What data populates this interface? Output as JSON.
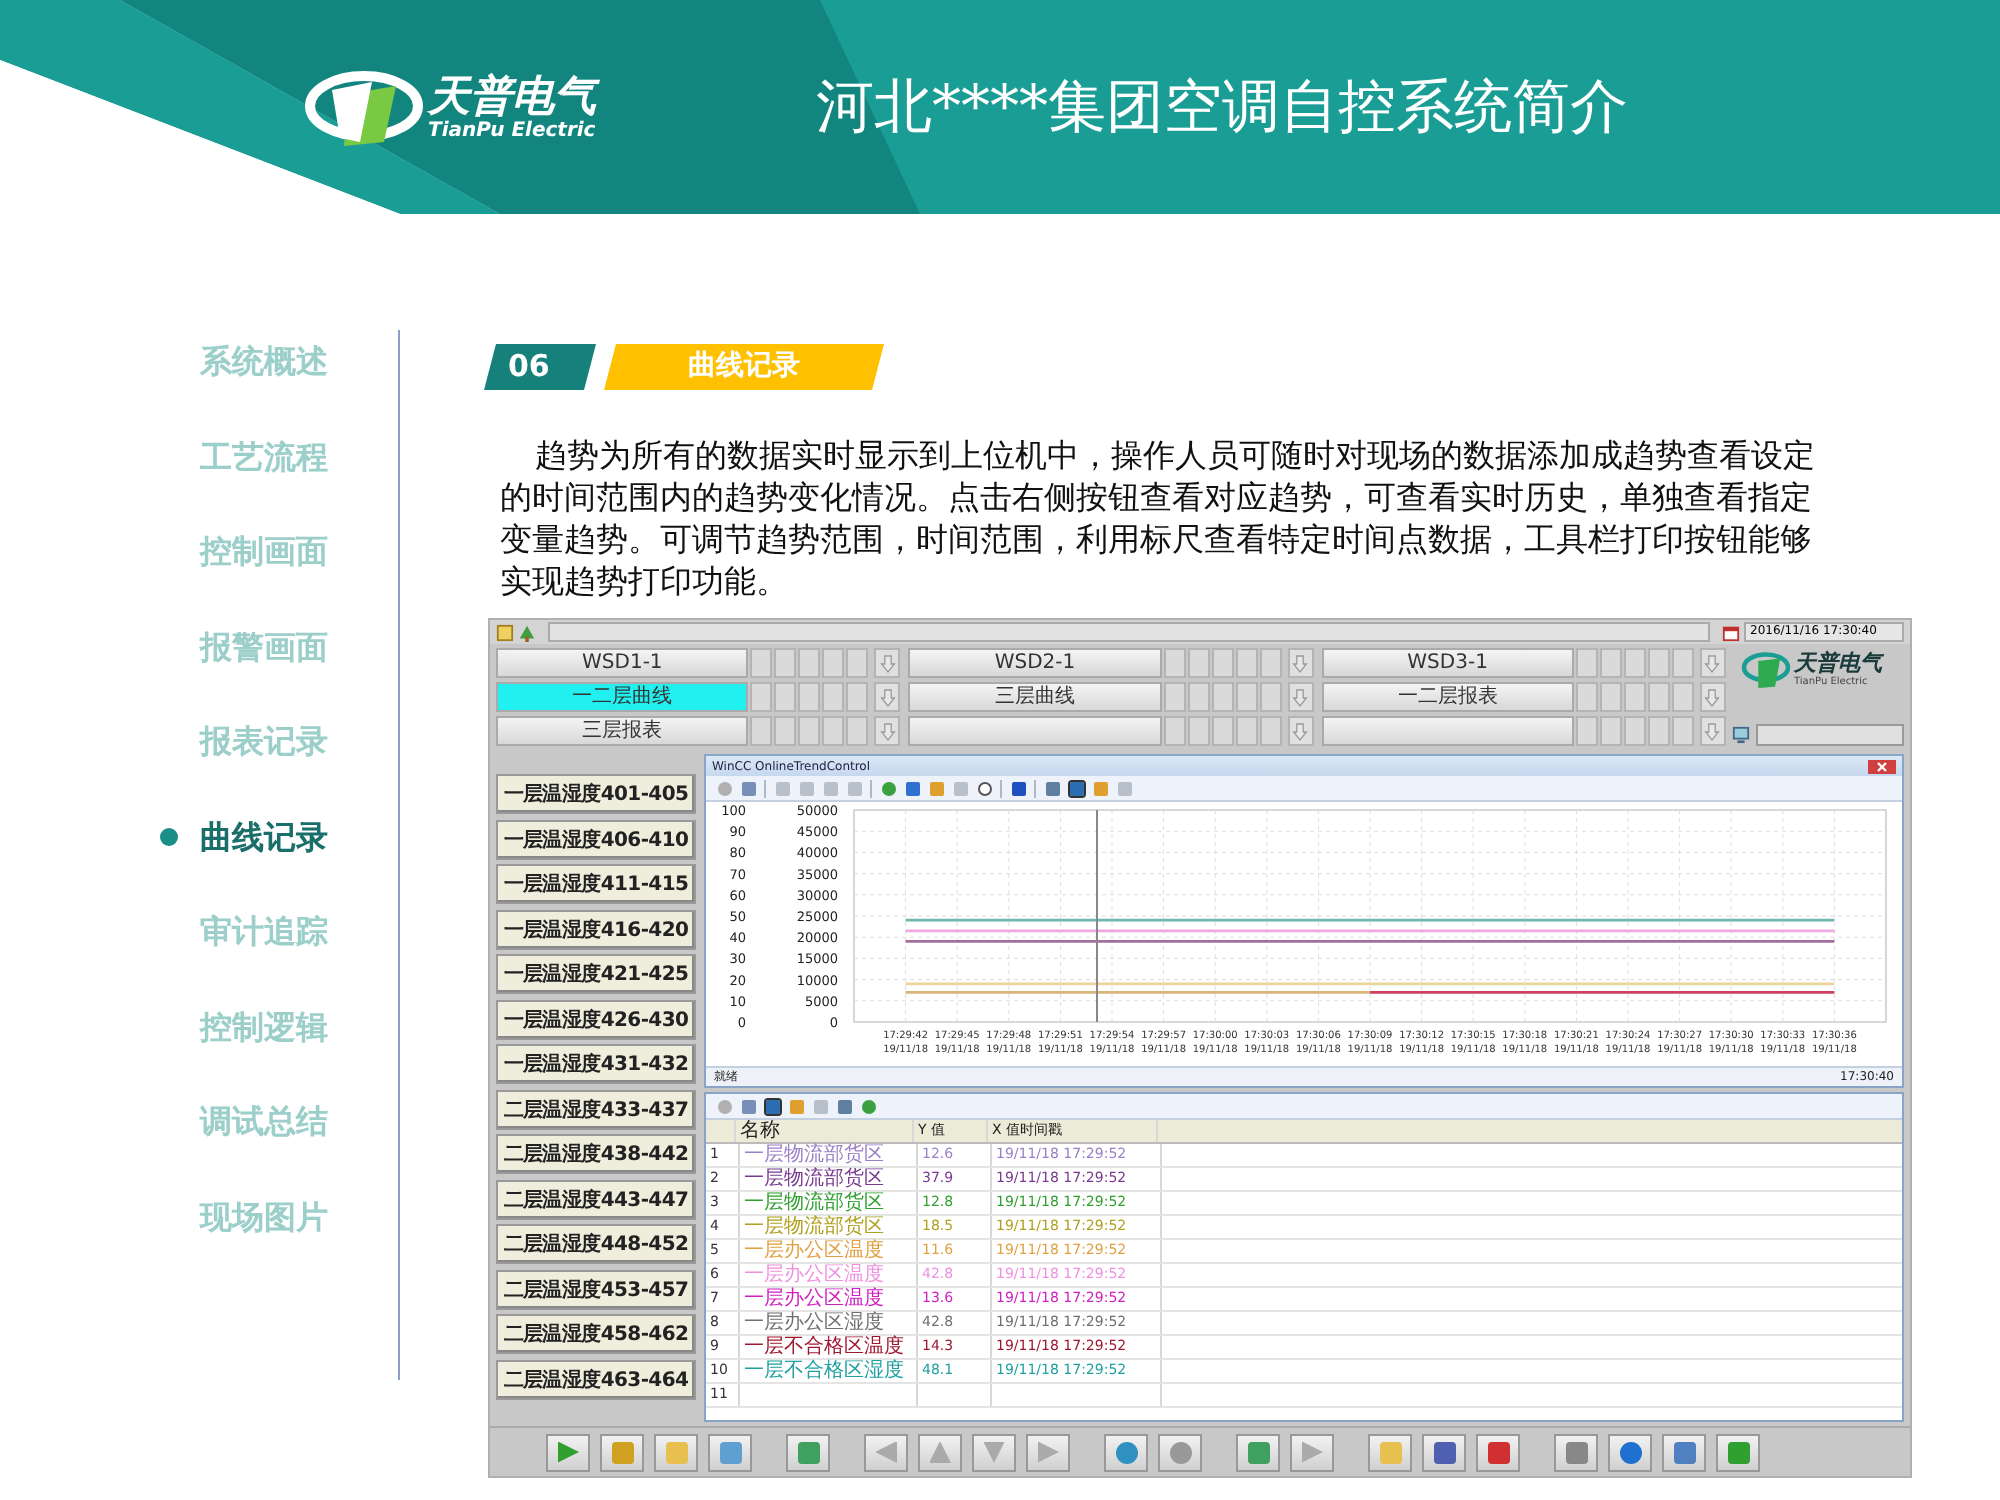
{
  "header": {
    "logo_text": "天普电气",
    "logo_subtext": "TianPu Electric",
    "title": "河北****集团空调自控系统简介"
  },
  "nav": {
    "items": [
      {
        "label": "系统概述",
        "selected": false
      },
      {
        "label": "工艺流程",
        "selected": false
      },
      {
        "label": "控制画面",
        "selected": false
      },
      {
        "label": "报警画面",
        "selected": false
      },
      {
        "label": "报表记录",
        "selected": false
      },
      {
        "label": "曲线记录",
        "selected": true
      },
      {
        "label": "审计追踪",
        "selected": false
      },
      {
        "label": "控制逻辑",
        "selected": false
      },
      {
        "label": "调试总结",
        "selected": false
      },
      {
        "label": "现场图片",
        "selected": false
      }
    ]
  },
  "section": {
    "number": "06",
    "title": "曲线记录",
    "paragraph": "趋势为所有的数据实时显示到上位机中，操作人员可随时对现场的数据添加成趋势查看设定的时间范围内的趋势变化情况。点击右侧按钮查看对应趋势，可查看实时历史，单独查看指定变量趋势。可调节趋势范围，时间范围，利用标尺查看特定时间点数据，工具栏打印按钮能够实现趋势打印功能。"
  },
  "scada": {
    "datetime": "2016/11/16 17:30:40",
    "logo_text": "天普电气",
    "logo_subtext": "TianPu Electric",
    "button_rows": [
      [
        {
          "label": "WSD1-1",
          "selected": false
        },
        {
          "label": "WSD2-1",
          "selected": false
        },
        {
          "label": "WSD3-1",
          "selected": false
        }
      ],
      [
        {
          "label": "一二层曲线",
          "selected": true
        },
        {
          "label": "三层曲线",
          "selected": false
        },
        {
          "label": "一二层报表",
          "selected": false
        }
      ],
      [
        {
          "label": "三层报表",
          "selected": false
        },
        {
          "selected": false
        },
        {
          "selected": false
        }
      ]
    ],
    "room_buttons": [
      "一层温湿度401-405",
      "一层温湿度406-410",
      "一层温湿度411-415",
      "一层温湿度416-420",
      "一层温湿度421-425",
      "一层温湿度426-430",
      "一层温湿度431-432",
      "二层温湿度433-437",
      "二层温湿度438-442",
      "二层温湿度443-447",
      "二层温湿度448-452",
      "二层温湿度453-457",
      "二层温湿度458-462",
      "二层温湿度463-464"
    ],
    "trend_window": {
      "title": "WinCC OnlineTrendControl",
      "status": "就绪",
      "time": "17:30:40",
      "chart_data": {
        "type": "line",
        "categories": [
          "17:29:42",
          "17:29:45",
          "17:29:48",
          "17:29:51",
          "17:29:54",
          "17:29:57",
          "17:30:00",
          "17:30:03",
          "17:30:06",
          "17:30:09",
          "17:30:12",
          "17:30:15",
          "17:30:18",
          "17:30:21",
          "17:30:24",
          "17:30:27",
          "17:30:30",
          "17:30:33",
          "17:30:36"
        ],
        "grid": true,
        "ylim": [
          0,
          50000
        ],
        "yticks": [
          0,
          5000,
          10000,
          15000,
          20000,
          25000,
          30000,
          35000,
          40000,
          45000,
          50000
        ],
        "series": [
          {
            "color": "#6fb7b0",
            "values": [
              24000,
              24000,
              24000,
              24000,
              24000,
              24000,
              24000,
              24000,
              24000,
              24000,
              24000,
              24000,
              24000,
              24000,
              24000,
              24000,
              24000,
              24000,
              24000
            ]
          },
          {
            "color": "#f0a8e0",
            "values": [
              21500,
              21500,
              21500,
              21500,
              21500,
              21500,
              21500,
              21500,
              21500,
              21500,
              21500,
              21500,
              21500,
              21500,
              21500,
              21500,
              21500,
              21500,
              21500
            ]
          },
          {
            "color": "#a0709a",
            "values": [
              19000,
              19000,
              19000,
              19000,
              19000,
              19000,
              19000,
              19000,
              19000,
              19000,
              19000,
              19000,
              19000,
              19000,
              19000,
              19000,
              19000,
              19000,
              19000
            ]
          },
          {
            "color": "#ecd49a",
            "values": [
              9000,
              9000,
              9000,
              9000,
              9000,
              9000,
              9000,
              9000,
              9000,
              9000,
              9000,
              9000,
              9000,
              9000,
              9000,
              9000,
              9000,
              9000,
              9000
            ]
          },
          {
            "color": "#d6b47a",
            "values": [
              7000,
              7000,
              7000,
              7000,
              7000,
              7000,
              7000,
              7000,
              7000,
              7000,
              null,
              null,
              null,
              null,
              null,
              null,
              null,
              null,
              null
            ]
          },
          {
            "color": "#d04060",
            "values": [
              null,
              null,
              null,
              null,
              null,
              null,
              null,
              null,
              null,
              7000,
              7000,
              7000,
              7000,
              7000,
              7000,
              7000,
              7000,
              7000,
              7000
            ]
          }
        ]
      },
      "secondary_axis_ticks": [
        "100",
        "90",
        "80",
        "70",
        "60",
        "50",
        "40",
        "30",
        "20",
        "10",
        "0"
      ],
      "date_labels": [
        "19/11/18",
        "19/11/18",
        "19/11/18",
        "19/11/18",
        "19/11/18",
        "19/11/18",
        "19/11/18",
        "19/11/18",
        "19/11/18",
        "19/11/18",
        "19/11/18",
        "19/11/18",
        "19/11/18",
        "19/11/18",
        "19/11/18",
        "19/11/18",
        "19/11/18",
        "19/11/18",
        "19/11/18"
      ]
    },
    "table_window": {
      "columns": [
        "名称",
        "Y 值",
        "X 值时间戳"
      ],
      "rows": [
        {
          "index": "1",
          "name": "一层物流部货区",
          "value": "12.6",
          "timestamp": "19/11/18 17:29:52",
          "color": "#9a80c8"
        },
        {
          "index": "2",
          "name": "一层物流部货区",
          "value": "37.9",
          "timestamp": "19/11/18 17:29:52",
          "color": "#7a3a90"
        },
        {
          "index": "3",
          "name": "一层物流部货区",
          "value": "12.8",
          "timestamp": "19/11/18 17:29:52",
          "color": "#30a030"
        },
        {
          "index": "4",
          "name": "一层物流部货区",
          "value": "18.5",
          "timestamp": "19/11/18 17:29:52",
          "color": "#b0a020"
        },
        {
          "index": "5",
          "name": "一层办公区温度",
          "value": "11.6",
          "timestamp": "19/11/18 17:29:52",
          "color": "#e0a040"
        },
        {
          "index": "6",
          "name": "一层办公区温度",
          "value": "42.8",
          "timestamp": "19/11/18 17:29:52",
          "color": "#f090e0"
        },
        {
          "index": "7",
          "name": "一层办公区温度",
          "value": "13.6",
          "timestamp": "19/11/18 17:29:52",
          "color": "#d020c0"
        },
        {
          "index": "8",
          "name": "一层办公区湿度",
          "value": "42.8",
          "timestamp": "19/11/18 17:29:52",
          "color": "#707070"
        },
        {
          "index": "9",
          "name": "一层不合格区温度",
          "value": "14.3",
          "timestamp": "19/11/18 17:29:52",
          "color": "#a01830"
        },
        {
          "index": "10",
          "name": "一层不合格区湿度",
          "value": "48.1",
          "timestamp": "19/11/18 17:29:52",
          "color": "#20a0a0"
        },
        {
          "index": "11"
        }
      ]
    }
  }
}
